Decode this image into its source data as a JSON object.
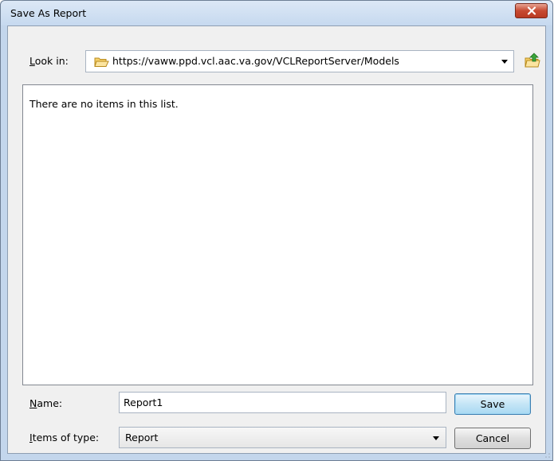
{
  "dialog": {
    "title": "Save As Report",
    "close_icon": "close-x-icon"
  },
  "lookin": {
    "label_prefix": "",
    "label_accel": "L",
    "label_rest": "ook in:",
    "path": "https://vaww.ppd.vcl.aac.va.gov/VCLReportServer/Models",
    "folder_icon": "folder-icon",
    "up_icon": "up-one-level-icon"
  },
  "list": {
    "empty_message": "There are no items in this list."
  },
  "name_field": {
    "label_accel": "N",
    "label_rest": "ame:",
    "value": "Report1"
  },
  "type_field": {
    "label_accel": "I",
    "label_rest": "tems of type:",
    "value": "Report"
  },
  "buttons": {
    "save_label": "Save",
    "cancel_label": "Cancel"
  },
  "colors": {
    "close_button": "#c74a32",
    "default_button": "#3c7fb1"
  }
}
